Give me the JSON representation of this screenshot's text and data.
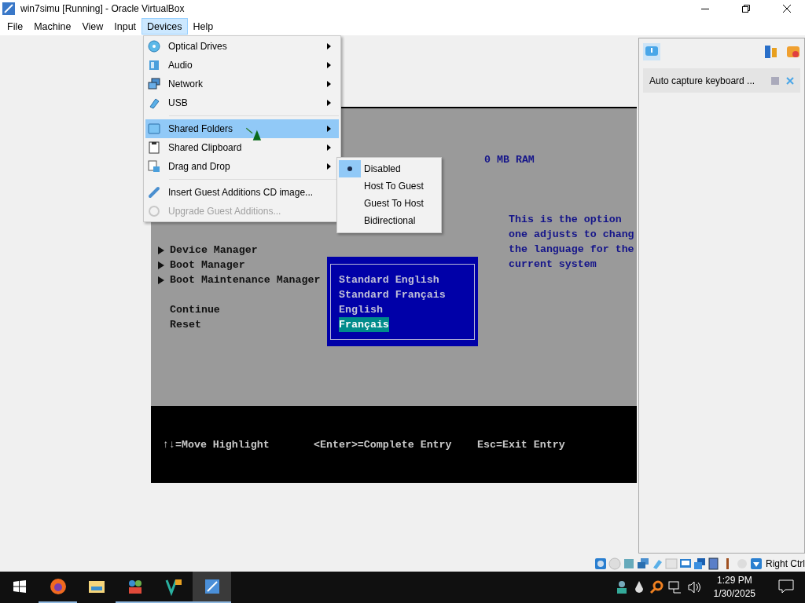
{
  "window": {
    "title": "win7simu [Running] - Oracle VirtualBox"
  },
  "menubar": [
    {
      "label": "File",
      "selected": false
    },
    {
      "label": "Machine",
      "selected": false
    },
    {
      "label": "View",
      "selected": false
    },
    {
      "label": "Input",
      "selected": false
    },
    {
      "label": "Devices",
      "selected": true
    },
    {
      "label": "Help",
      "selected": false
    }
  ],
  "devices_menu": {
    "groups": [
      [
        {
          "label": "Optical Drives",
          "submenu": true,
          "selected": false,
          "disabled": false
        },
        {
          "label": "Audio",
          "submenu": true,
          "selected": false,
          "disabled": false
        },
        {
          "label": "Network",
          "submenu": true,
          "selected": false,
          "disabled": false
        },
        {
          "label": "USB",
          "submenu": true,
          "selected": false,
          "disabled": false
        }
      ],
      [
        {
          "label": "Shared Folders",
          "submenu": true,
          "selected": true,
          "disabled": false
        },
        {
          "label": "Shared Clipboard",
          "submenu": true,
          "selected": false,
          "disabled": false
        },
        {
          "label": "Drag and Drop",
          "submenu": true,
          "selected": false,
          "disabled": false
        }
      ],
      [
        {
          "label": "Insert Guest Additions CD image...",
          "submenu": false,
          "selected": false,
          "disabled": false
        },
        {
          "label": "Upgrade Guest Additions...",
          "submenu": false,
          "selected": false,
          "disabled": true
        }
      ]
    ]
  },
  "drag_and_drop_submenu": [
    {
      "label": "Disabled",
      "checked": true
    },
    {
      "label": "Host To Guest",
      "checked": false
    },
    {
      "label": "Guest To Host",
      "checked": false
    },
    {
      "label": "Bidirectional",
      "checked": false
    }
  ],
  "guest_screen": {
    "memory": "0 MB RAM",
    "menu_items": [
      {
        "kind": "submenu",
        "label": "Device Manager"
      },
      {
        "kind": "submenu",
        "label": "Boot Manager"
      },
      {
        "kind": "submenu",
        "label": "Boot Maintenance Manager"
      },
      {
        "kind": "spacer"
      },
      {
        "kind": "action",
        "label": "Continue"
      },
      {
        "kind": "action",
        "label": "Reset"
      }
    ],
    "help_text": [
      "This is the option",
      "one adjusts to chang",
      "the language for the",
      "current system"
    ],
    "language_options": [
      {
        "label": "Standard English",
        "selected": false
      },
      {
        "label": "Standard Français",
        "selected": false
      },
      {
        "label": "English",
        "selected": false
      },
      {
        "label": "Français",
        "selected": true
      }
    ],
    "footer": [
      "↑↓=Move Highlight",
      "<Enter>=Complete Entry",
      "Esc=Exit Entry"
    ]
  },
  "notification_panel": {
    "message": "Auto capture keyboard ..."
  },
  "status_bar": {
    "host_key": "Right Ctrl"
  },
  "taskbar": {
    "apps": [
      {
        "running": true,
        "selected": false
      },
      {
        "running": false,
        "selected": false
      },
      {
        "running": true,
        "selected": false
      },
      {
        "running": true,
        "selected": false
      },
      {
        "running": true,
        "selected": true
      }
    ],
    "time": "1:29 PM",
    "date": "1/30/2025"
  }
}
